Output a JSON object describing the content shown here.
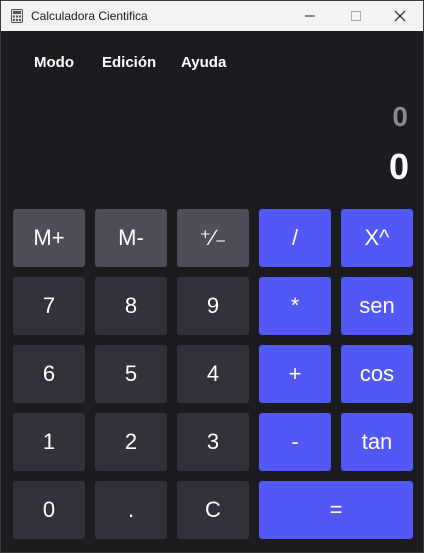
{
  "window": {
    "title": "Calculadora Cientifica"
  },
  "menu": {
    "modo": "Modo",
    "edicion": "Edición",
    "ayuda": "Ayuda"
  },
  "display": {
    "previous": "0",
    "current": "0"
  },
  "keys": {
    "r1": [
      "M+",
      "M-",
      "⁺∕₋",
      "/",
      "X^"
    ],
    "r2": [
      "7",
      "8",
      "9",
      "*",
      "sen"
    ],
    "r3": [
      "6",
      "5",
      "4",
      "+",
      "cos"
    ],
    "r4": [
      "1",
      "2",
      "3",
      "-",
      "tan"
    ],
    "r5": [
      "0",
      ".",
      "C",
      "="
    ]
  },
  "colors": {
    "background": "#1c1b20",
    "memory_key": "#4e4e58",
    "number_key": "#33323a",
    "operator_key": "#5158f6",
    "previous_text": "#8a8a8a"
  }
}
